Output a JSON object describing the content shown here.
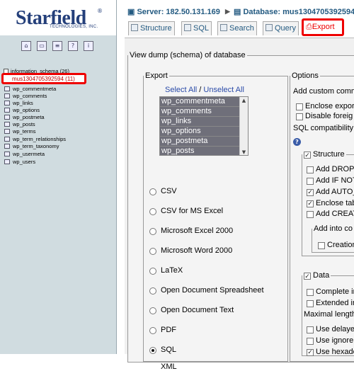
{
  "brand": {
    "name": "Starfield",
    "registered": "®",
    "subtitle": "TECHNOLOGIES, INC."
  },
  "sidebar": {
    "database_above": "information_schema (26)",
    "active_database": "mus1304705392594 (11)",
    "tables": [
      "wp_commentmeta",
      "wp_comments",
      "wp_links",
      "wp_options",
      "wp_postmeta",
      "wp_posts",
      "wp_terms",
      "wp_term_relationships",
      "wp_term_taxonomy",
      "wp_usermeta",
      "wp_users"
    ],
    "icons": [
      "home-icon",
      "sql-window-icon",
      "sql-icon",
      "docs-icon",
      "info-icon"
    ]
  },
  "breadcrumb": {
    "server": "Server: 182.50.131.169",
    "sep": "▶",
    "database": "Database: mus1304705392594"
  },
  "tabs": [
    {
      "label": "Structure"
    },
    {
      "label": "SQL"
    },
    {
      "label": "Search"
    },
    {
      "label": "Query"
    },
    {
      "label": "Export"
    }
  ],
  "export_panel": {
    "outer_legend": "View dump (schema) of database",
    "export_legend": "Export",
    "select_all": "Select All",
    "slash": " / ",
    "unselect_all": "Unselect All",
    "table_options": [
      "wp_commentmeta",
      "wp_comments",
      "wp_links",
      "wp_options",
      "wp_postmeta",
      "wp_posts"
    ],
    "formats": [
      "CSV",
      "CSV for MS Excel",
      "Microsoft Excel 2000",
      "Microsoft Word 2000",
      "LaTeX",
      "Open Document Spreadsheet",
      "Open Document Text",
      "PDF",
      "SQL",
      "XML"
    ],
    "selected_format": "SQL"
  },
  "options_panel": {
    "legend": "Options",
    "add_custom": "Add custom comm",
    "enclose_export": "Enclose expor",
    "disable_foreign": "Disable foreig",
    "sql_compat": "SQL compatibility",
    "structure_legend": "Structure",
    "structure_items": [
      {
        "label": "Add DROP",
        "checked": false
      },
      {
        "label": "Add IF NOT",
        "checked": false
      },
      {
        "label": "Add AUTO_",
        "checked": true
      },
      {
        "label": "Enclose tab",
        "checked": true
      },
      {
        "label": "Add CREAT",
        "checked": false
      }
    ],
    "add_into_legend": "Add into co",
    "creation": "Creation",
    "data_legend": "Data",
    "data_items": [
      {
        "label": "Complete in",
        "checked": false
      },
      {
        "label": "Extended in",
        "checked": false
      }
    ],
    "maximal_length": "Maximal length",
    "data_items2": [
      {
        "label": "Use delaye",
        "checked": false
      },
      {
        "label": "Use ignore",
        "checked": false
      },
      {
        "label": "Use hexade",
        "checked": true
      }
    ]
  }
}
